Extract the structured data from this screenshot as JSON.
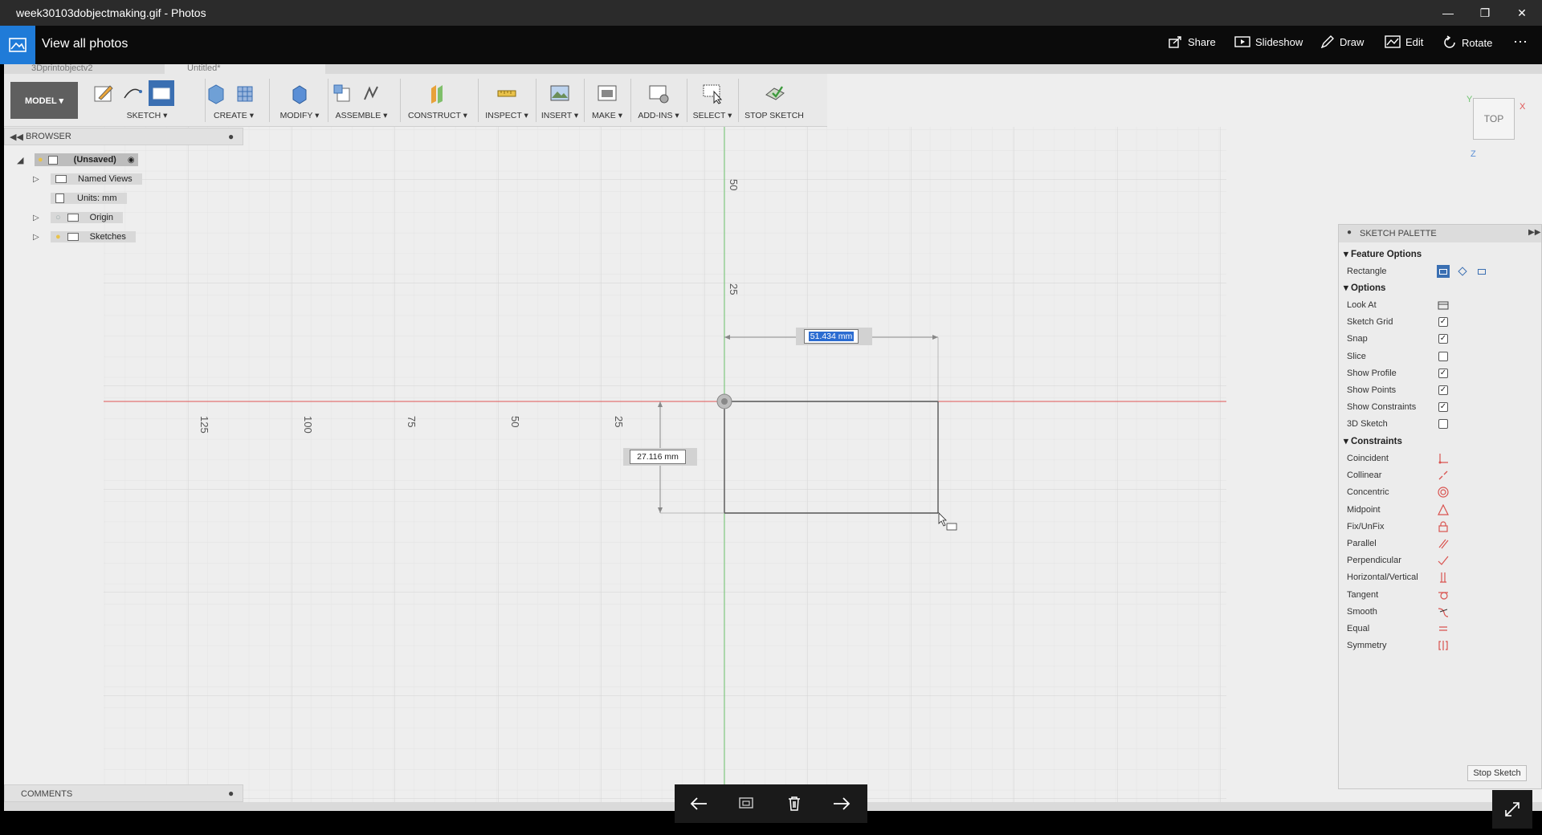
{
  "window": {
    "title": "week30103dobjectmaking.gif - Photos",
    "controls": [
      "minimize-icon",
      "restore-icon",
      "close-icon"
    ]
  },
  "photos_bar": {
    "view_all": "View all photos",
    "actions": [
      {
        "label": "Share",
        "icon": "share-icon"
      },
      {
        "label": "Slideshow",
        "icon": "slideshow-icon"
      },
      {
        "label": "Draw",
        "icon": "draw-icon"
      },
      {
        "label": "Edit",
        "icon": "edit-icon"
      },
      {
        "label": "Rotate",
        "icon": "rotate-icon"
      }
    ],
    "more": "⋯"
  },
  "fusion": {
    "doc_tabs": [
      "3Dprintobjectv2",
      "Untitled*"
    ],
    "toolbar": {
      "workspace": "MODEL ▾",
      "groups": [
        {
          "label": "SKETCH ▾"
        },
        {
          "label": "CREATE ▾"
        },
        {
          "label": "MODIFY ▾"
        },
        {
          "label": "ASSEMBLE ▾"
        },
        {
          "label": "CONSTRUCT ▾"
        },
        {
          "label": "INSPECT ▾"
        },
        {
          "label": "INSERT ▾"
        },
        {
          "label": "MAKE ▾"
        },
        {
          "label": "ADD-INS ▾"
        },
        {
          "label": "SELECT ▾"
        },
        {
          "label": "STOP SKETCH"
        }
      ]
    },
    "browser": {
      "title": "BROWSER",
      "root": "(Unsaved)",
      "items": [
        {
          "label": "Named Views"
        },
        {
          "label": "Units: mm"
        },
        {
          "label": "Origin"
        },
        {
          "label": "Sketches"
        }
      ]
    },
    "comments": "COMMENTS",
    "viewport": {
      "axis_labels_x": [
        "125",
        "100",
        "75",
        "50",
        "25"
      ],
      "axis_labels_y": [
        "50",
        "25"
      ],
      "dimension_width": "51.434 mm",
      "dimension_height": "27.116 mm",
      "viewcube": "TOP",
      "axis_letters": {
        "x": "X",
        "y": "Y",
        "z": "Z"
      }
    },
    "sketch_palette": {
      "title": "SKETCH PALETTE",
      "feature_options": {
        "title": "Feature Options",
        "rectangle": "Rectangle"
      },
      "options": {
        "title": "Options",
        "items": [
          {
            "label": "Look At",
            "type": "icon",
            "checked": false
          },
          {
            "label": "Sketch Grid",
            "type": "check",
            "checked": true
          },
          {
            "label": "Snap",
            "type": "check",
            "checked": true
          },
          {
            "label": "Slice",
            "type": "check",
            "checked": false
          },
          {
            "label": "Show Profile",
            "type": "check",
            "checked": true
          },
          {
            "label": "Show Points",
            "type": "check",
            "checked": true
          },
          {
            "label": "Show Constraints",
            "type": "check",
            "checked": true
          },
          {
            "label": "3D Sketch",
            "type": "check",
            "checked": false
          }
        ]
      },
      "constraints": {
        "title": "Constraints",
        "items": [
          {
            "label": "Coincident",
            "icon": "coincident-icon"
          },
          {
            "label": "Collinear",
            "icon": "collinear-icon"
          },
          {
            "label": "Concentric",
            "icon": "concentric-icon"
          },
          {
            "label": "Midpoint",
            "icon": "midpoint-icon"
          },
          {
            "label": "Fix/UnFix",
            "icon": "lock-icon"
          },
          {
            "label": "Parallel",
            "icon": "parallel-icon"
          },
          {
            "label": "Perpendicular",
            "icon": "perpendicular-icon"
          },
          {
            "label": "Horizontal/Vertical",
            "icon": "horizontal-vertical-icon"
          },
          {
            "label": "Tangent",
            "icon": "tangent-icon"
          },
          {
            "label": "Smooth",
            "icon": "smooth-icon"
          },
          {
            "label": "Equal",
            "icon": "equal-icon"
          },
          {
            "label": "Symmetry",
            "icon": "symmetry-icon"
          }
        ]
      },
      "stop_sketch": "Stop Sketch"
    }
  },
  "colors": {
    "accent": "#1f7bd8",
    "x_axis": "#e05555",
    "y_axis": "#6cc36c",
    "constraint_red": "#d9534f",
    "active_tool": "#3a6fb2"
  }
}
